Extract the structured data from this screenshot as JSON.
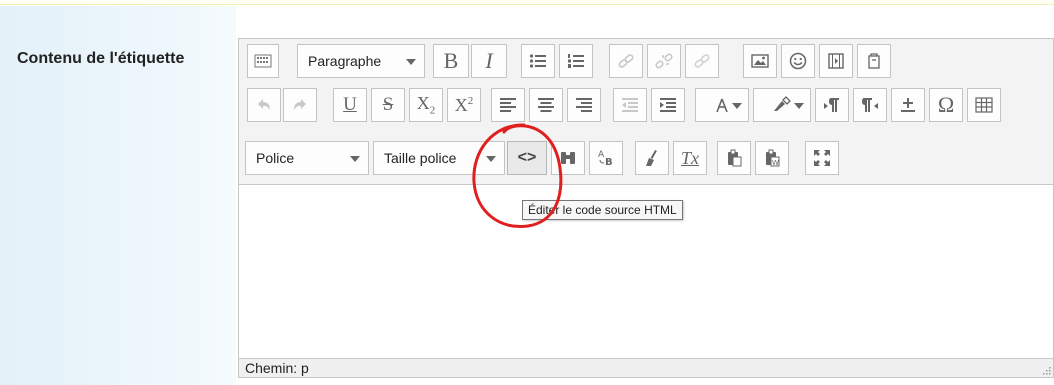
{
  "form": {
    "field_label": "Contenu de l'étiquette"
  },
  "toolbar": {
    "row1": {
      "toggle_label": "toolbar-toggle",
      "format_select": "Paragraphe",
      "bold": "B",
      "italic": "I"
    },
    "row2": {
      "underline": "U",
      "strikethrough": "S",
      "subscript_base": "X",
      "subscript_mark": "2",
      "superscript_base": "X",
      "superscript_mark": "2",
      "special_char": "Ω"
    },
    "row3": {
      "font_select": "Police",
      "size_select": "Taille police",
      "html_button": "<>",
      "clear_format": "Tx"
    }
  },
  "tooltip": {
    "text": "Éditer le code source HTML"
  },
  "statusbar": {
    "path": "Chemin: p"
  },
  "colors": {
    "panel_bg": "#e3f1f9",
    "annotation": "#e0201f",
    "border": "#c4c4c4"
  }
}
